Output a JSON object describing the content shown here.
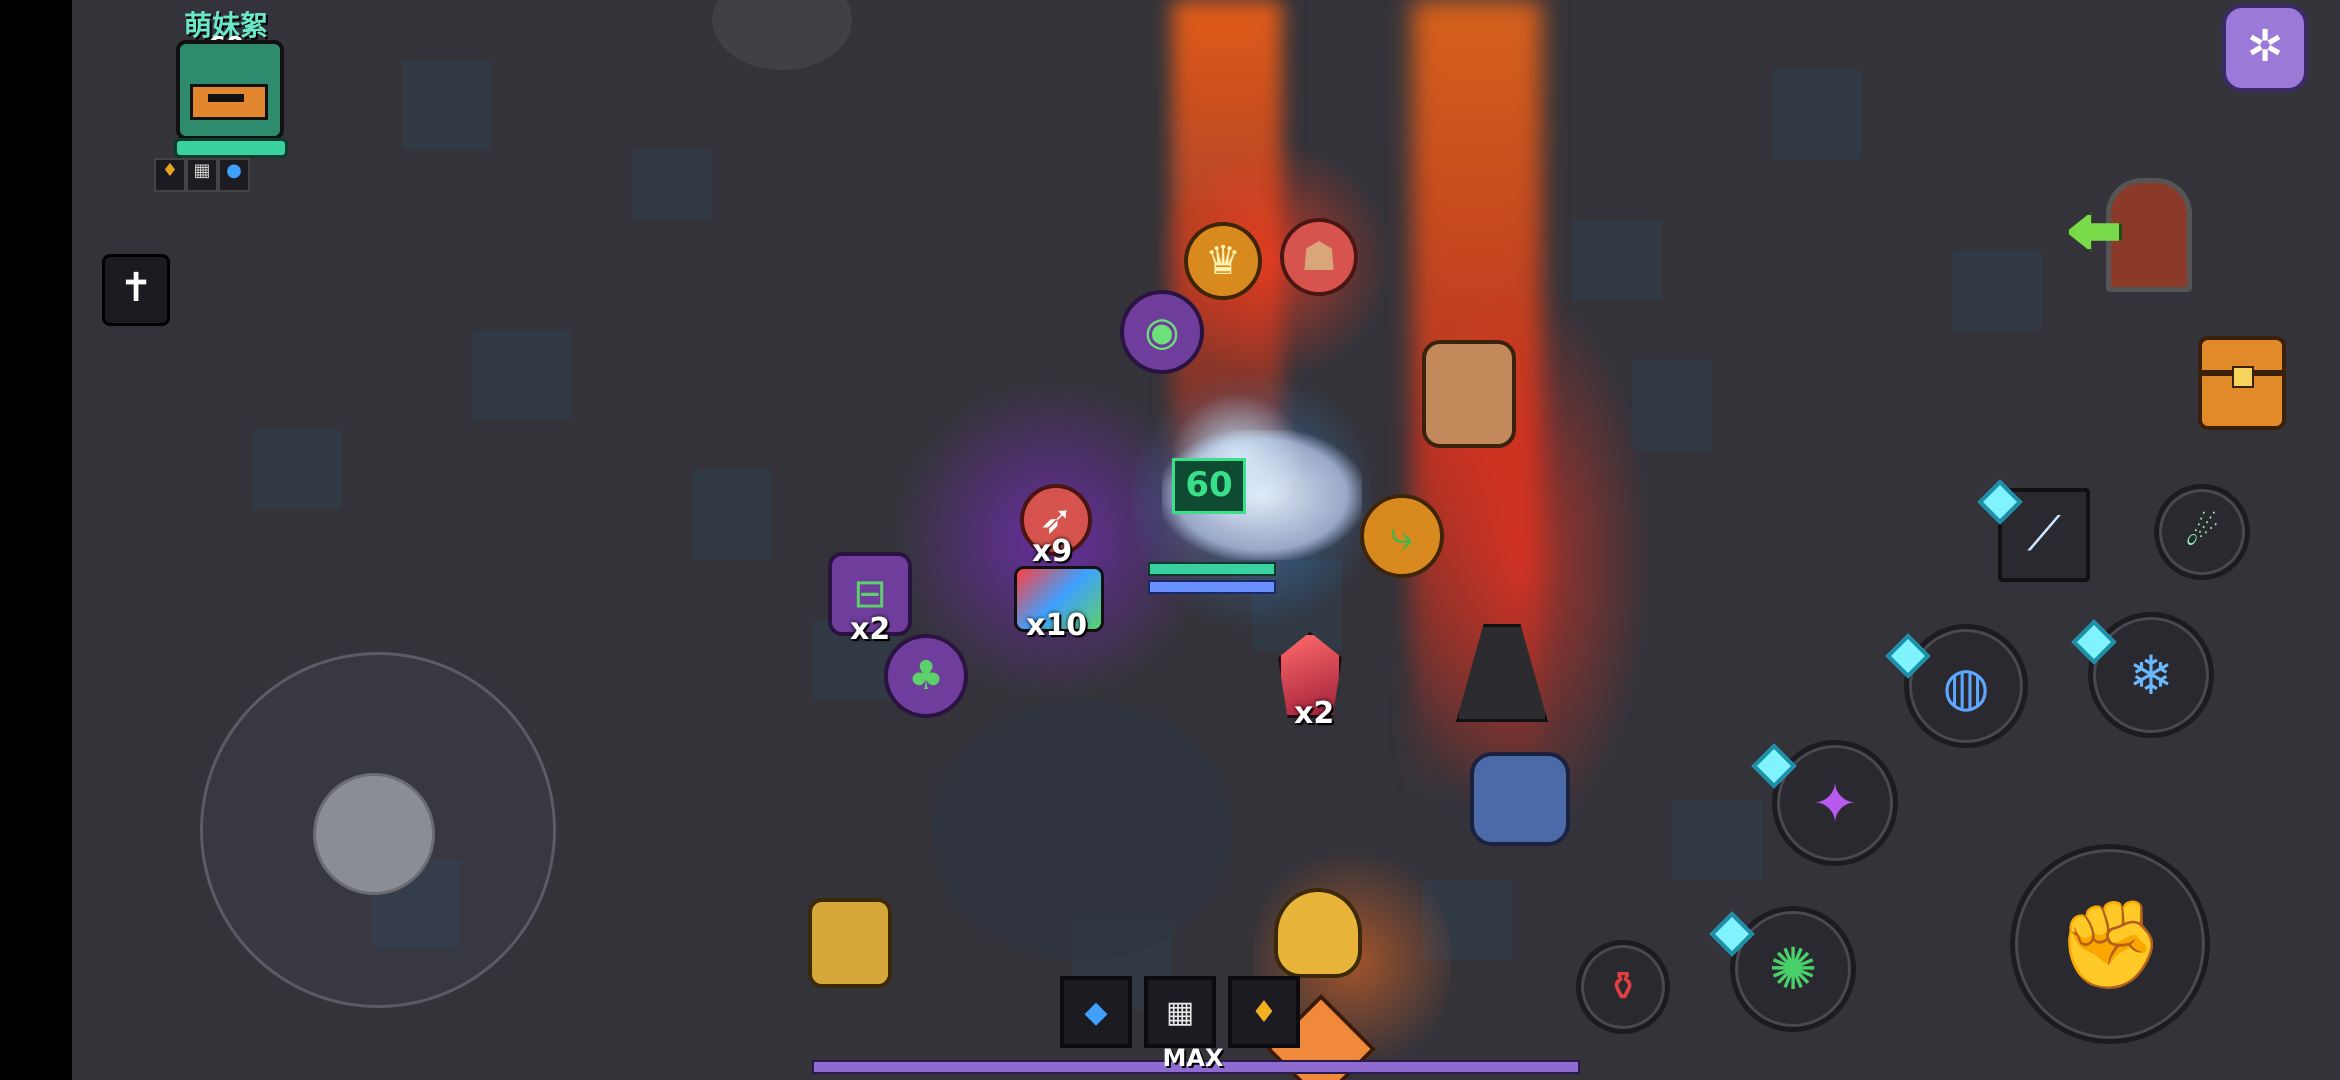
{
  "player": {
    "name": "萌妹絮",
    "level": "60"
  },
  "hero": {
    "level_tag": "60"
  },
  "loot": {
    "goggles_count": "x2",
    "arrow_count": "x9",
    "gems_count": "x10",
    "crystal_count": "x2"
  },
  "xp_bar": {
    "label": "MAX"
  },
  "colors": {
    "background": "#34333a",
    "beam_red": "#ff3a1a",
    "beam_orange": "#ff7a1e",
    "aura_purple": "#8a2be2",
    "aura_blue": "#3fa0ff",
    "hp_green": "#3ad1a0",
    "xp_purple": "#8e6bd1"
  },
  "icons": {
    "settings": "settings-icon",
    "exit": "exit-door-icon",
    "chest": "treasure-chest-icon",
    "weapon": "weapon-switch-icon",
    "dash": "dash-skill-icon",
    "attack": "attack-fist-icon",
    "potion": "potion-icon"
  }
}
